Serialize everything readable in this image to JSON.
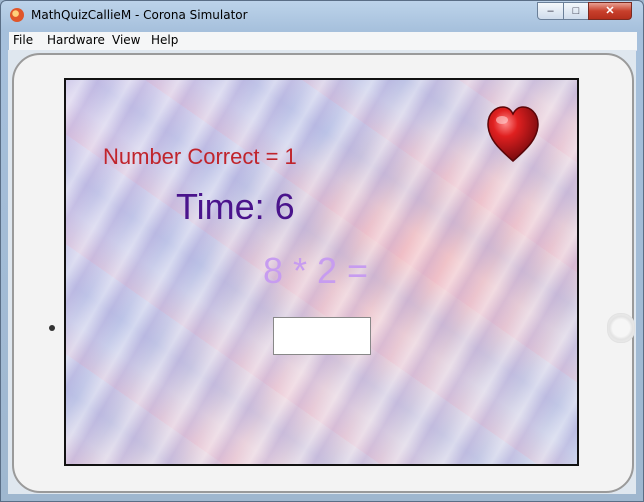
{
  "window": {
    "title": "MathQuizCallieM - Corona Simulator",
    "buttons": {
      "minimize": "–",
      "maximize": "□",
      "close": "✕"
    }
  },
  "menu": {
    "items": [
      {
        "label": "File"
      },
      {
        "label": "Hardware"
      },
      {
        "label": "View"
      },
      {
        "label": "Help"
      }
    ]
  },
  "game": {
    "score_text": "Number Correct = 1",
    "timer_text": "Time: 6",
    "question_text": "8 * 2 =",
    "answer_value": "",
    "lives_icon": "heart-icon"
  },
  "colors": {
    "score": "#c0242c",
    "timer": "#4a148c",
    "question": "#c79cf0",
    "heart": "#c8141e"
  }
}
